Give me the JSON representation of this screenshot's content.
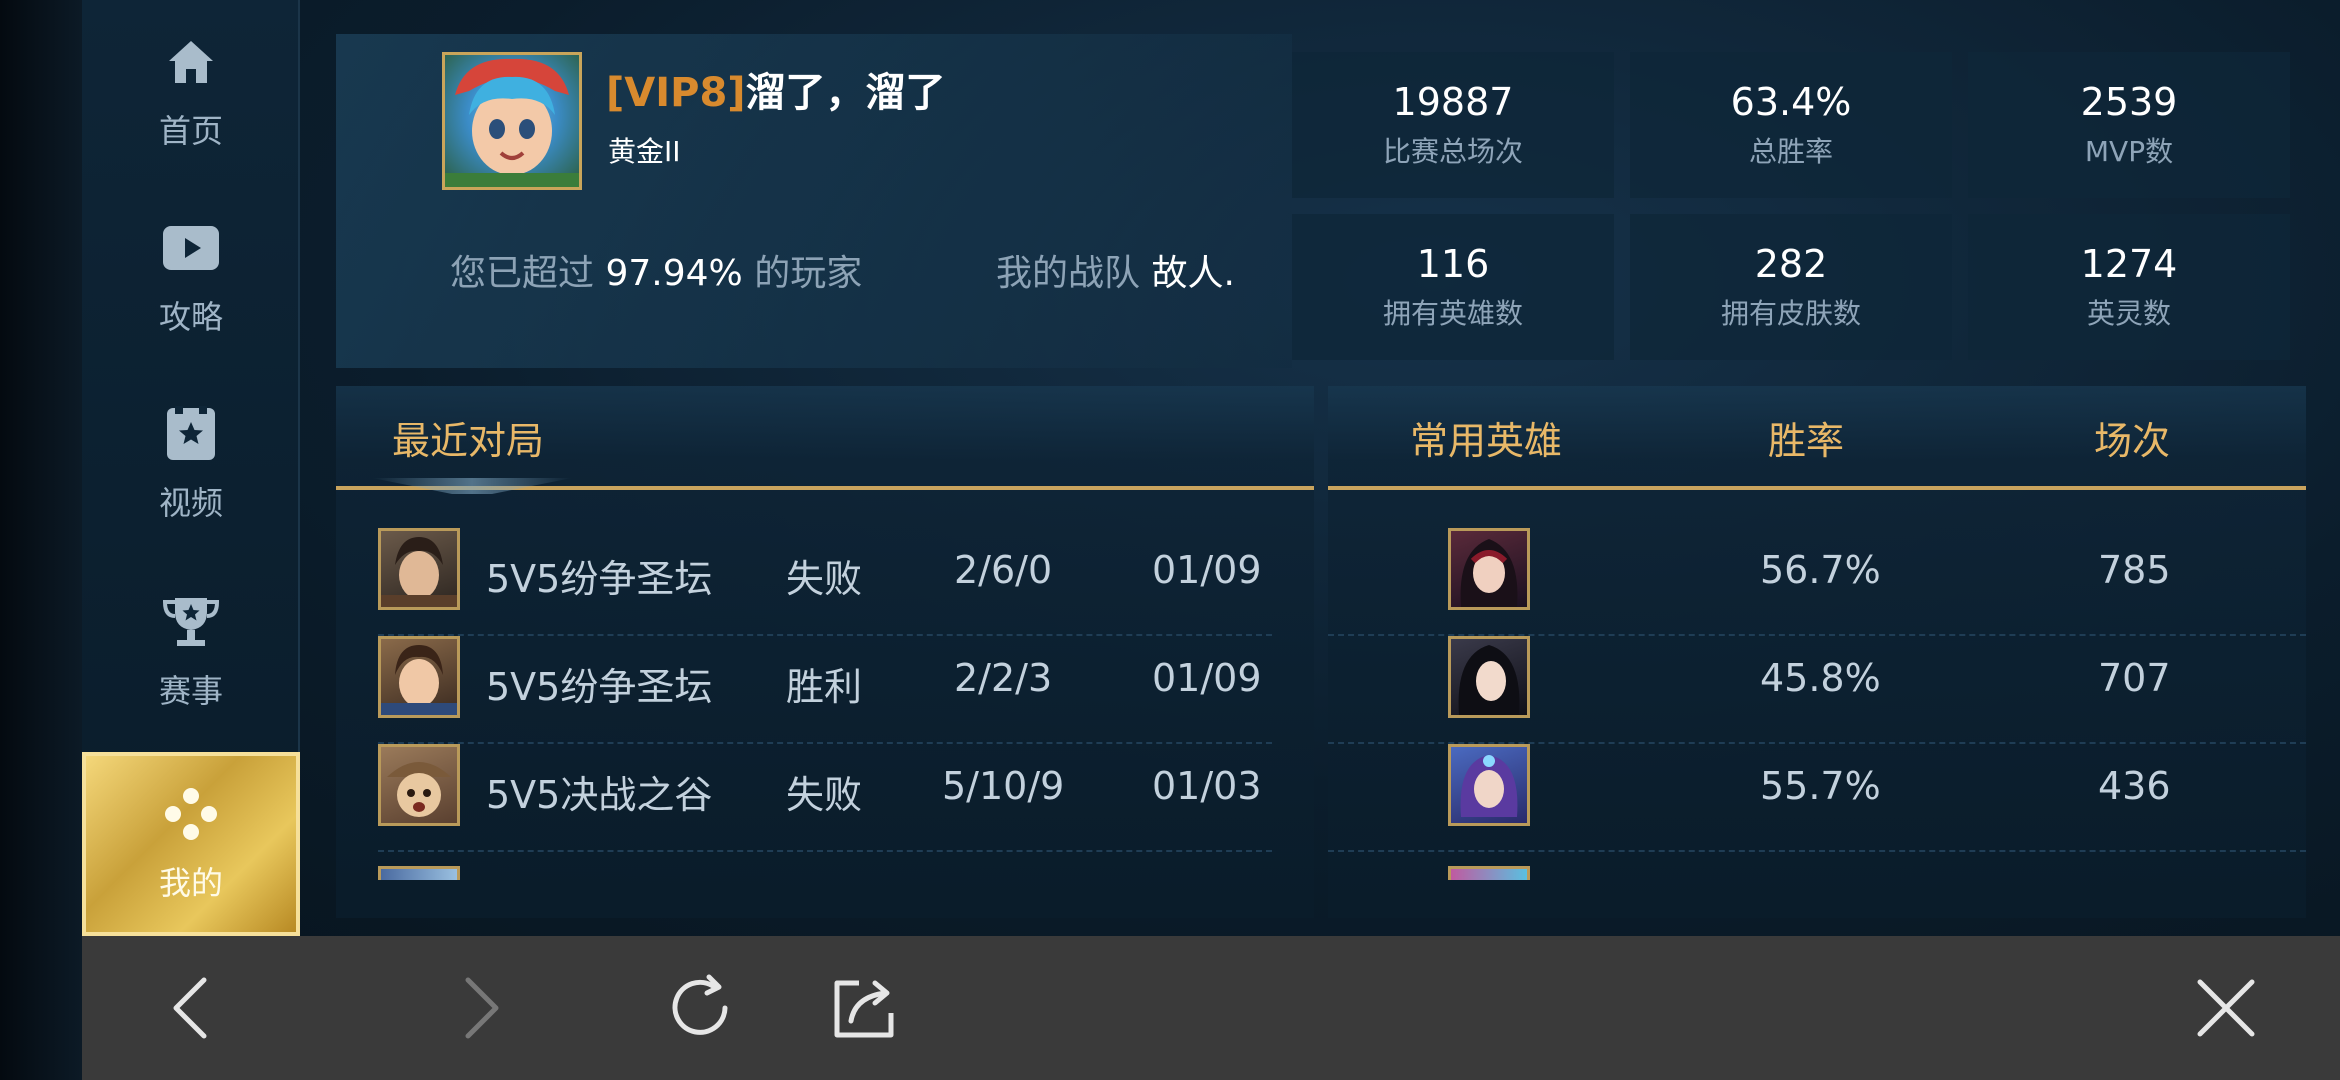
{
  "sidebar": {
    "items": [
      {
        "label": "首页",
        "icon": "home-icon"
      },
      {
        "label": "攻略",
        "icon": "video-play-icon"
      },
      {
        "label": "视频",
        "icon": "film-star-icon"
      },
      {
        "label": "赛事",
        "icon": "trophy-icon"
      },
      {
        "label": "我的",
        "icon": "gamepad-icon",
        "active": true
      }
    ]
  },
  "profile": {
    "vip": "[VIP8]",
    "name": "溜了，溜了",
    "rank": "黄金II",
    "exceed_prefix": "您已超过",
    "exceed_pct": "97.94%",
    "exceed_suffix": "的玩家",
    "team_label": "我的战队",
    "team_name": "故人."
  },
  "stats": [
    {
      "value": "19887",
      "label": "比赛总场次"
    },
    {
      "value": "63.4%",
      "label": "总胜率"
    },
    {
      "value": "2539",
      "label": "MVP数"
    },
    {
      "value": "116",
      "label": "拥有英雄数"
    },
    {
      "value": "282",
      "label": "拥有皮肤数"
    },
    {
      "value": "1274",
      "label": "英灵数"
    }
  ],
  "recent": {
    "title": "最近对局",
    "matches": [
      {
        "mode": "5V5纷争圣坛",
        "result": "失败",
        "kda": "2/6/0",
        "date": "01/09"
      },
      {
        "mode": "5V5纷争圣坛",
        "result": "胜利",
        "kda": "2/2/3",
        "date": "01/09"
      },
      {
        "mode": "5V5决战之谷",
        "result": "失败",
        "kda": "5/10/9",
        "date": "01/03"
      }
    ]
  },
  "heroes": {
    "col_hero": "常用英雄",
    "col_winrate": "胜率",
    "col_games": "场次",
    "rows": [
      {
        "winrate": "56.7%",
        "games": "785"
      },
      {
        "winrate": "45.8%",
        "games": "707"
      },
      {
        "winrate": "55.7%",
        "games": "436"
      }
    ]
  },
  "browser": {
    "icons": [
      "back-arrow-icon",
      "forward-arrow-icon",
      "refresh-icon",
      "share-icon",
      "close-icon"
    ]
  },
  "colors": {
    "accent_gold": "#e8b868",
    "vip_orange": "#d88a2e",
    "active_tab_gold": "#d9b44a"
  }
}
